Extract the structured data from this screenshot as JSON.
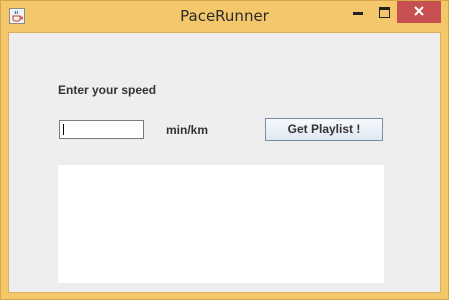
{
  "window": {
    "title": "PaceRunner",
    "title_bar_color": "#f4c76a",
    "close_button_color": "#c75050"
  },
  "icons": {
    "app": "java-cup-icon",
    "minimize": "minimize-icon",
    "maximize": "maximize-icon",
    "close": "close-icon"
  },
  "form": {
    "speed_label": "Enter your speed",
    "speed_value": "",
    "unit_label": "min/km",
    "submit_label": "Get Playlist !"
  },
  "output": {
    "text": ""
  }
}
